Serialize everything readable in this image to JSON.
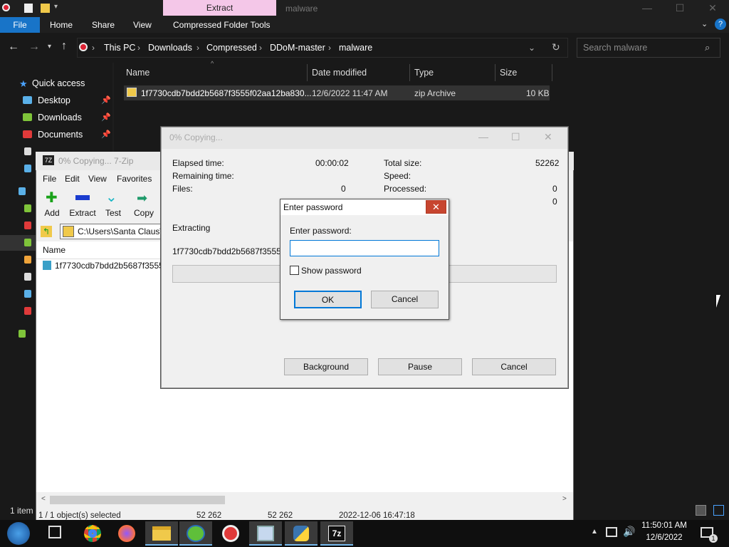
{
  "explorer": {
    "context_tab": "Extract",
    "title": "malware",
    "ribbon_tabs": [
      "File",
      "Home",
      "Share",
      "View",
      "Compressed Folder Tools"
    ],
    "breadcrumbs": [
      "This PC",
      "Downloads",
      "Compressed",
      "DDoM-master",
      "malware"
    ],
    "search_placeholder": "Search malware",
    "nav": {
      "quick_access": "Quick access",
      "items": [
        "Desktop",
        "Downloads",
        "Documents"
      ]
    },
    "columns": [
      "Name",
      "Date modified",
      "Type",
      "Size"
    ],
    "file": {
      "name": "1f7730cdb7bdd2b5687f3555f02aa12ba830...",
      "date": "12/6/2022 11:47 AM",
      "type": "zip Archive",
      "size": "10 KB"
    },
    "status_items": "1 item"
  },
  "zip": {
    "title": "0% Copying... 7-Zip",
    "menu": [
      "File",
      "Edit",
      "View",
      "Favorites"
    ],
    "toolbar": [
      "Add",
      "Extract",
      "Test",
      "Copy"
    ],
    "path": "C:\\Users\\Santa Claus\\",
    "list_header": "Name",
    "list_item": "1f7730cdb7bdd2b5687f3555f",
    "status": {
      "selected": "1 / 1 object(s) selected",
      "size1": "52 262",
      "size2": "52 262",
      "date": "2022-12-06 16:47:18"
    }
  },
  "copy": {
    "title": "0% Copying...",
    "elapsed_label": "Elapsed time:",
    "elapsed_value": "00:00:02",
    "remaining_label": "Remaining time:",
    "files_label": "Files:",
    "files_value": "0",
    "total_label": "Total size:",
    "total_value": "52262",
    "speed_label": "Speed:",
    "processed_label": "Processed:",
    "processed_value": "0",
    "extra_value": "0",
    "extracting_label": "Extracting",
    "extracting_file": "1f7730cdb7bdd2b5687f3555f02",
    "buttons": [
      "Background",
      "Pause",
      "Cancel"
    ]
  },
  "password": {
    "title": "Enter password",
    "label": "Enter password:",
    "value": "",
    "show_password": "Show password",
    "ok": "OK",
    "cancel": "Cancel"
  },
  "taskbar": {
    "time": "11:50:01 AM",
    "date": "12/6/2022",
    "notification_count": "1"
  },
  "colors": {
    "file_tab": "#1874c8",
    "context_tab": "#f4c7e8",
    "close_red": "#c7452f",
    "focus_blue": "#0078d7"
  }
}
